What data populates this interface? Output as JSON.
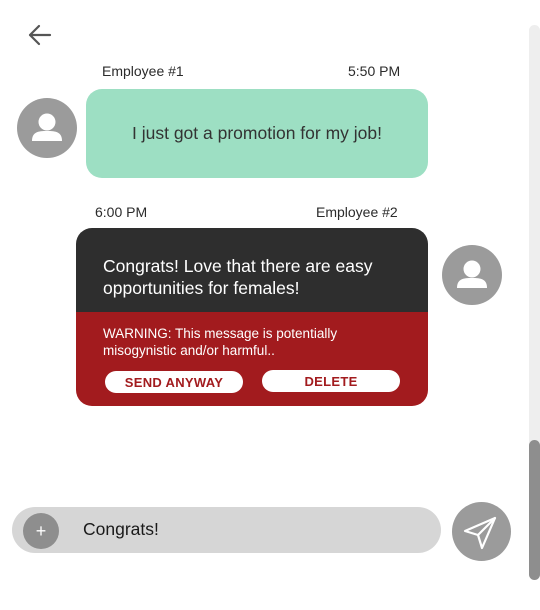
{
  "messages": [
    {
      "sender": "Employee #1",
      "time": "5:50 PM",
      "text": "I just got a promotion for my job!",
      "bubble_color": "#9ddfc3"
    },
    {
      "sender": "Employee #2",
      "time": "6:00 PM",
      "text": "Congrats! Love that there are easy opportunities for females!",
      "bubble_color": "#2e2e2e",
      "warning": {
        "text": "WARNING: This message is potentially misogynistic and/or harmful..",
        "color": "#a21b1e",
        "send_anyway_label": "SEND ANYWAY",
        "delete_label": "DELETE"
      }
    }
  ],
  "composer": {
    "plus_label": "+",
    "value": "Congrats!"
  },
  "icons": {
    "back": "arrow-left-icon",
    "avatar": "user-icon",
    "send": "paper-plane-icon"
  }
}
